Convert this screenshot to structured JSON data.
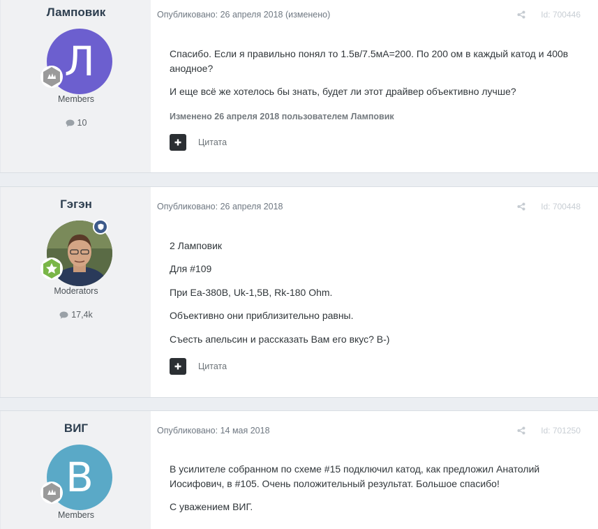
{
  "posts": [
    {
      "author": "Ламповик",
      "avatar_letter": "Л",
      "avatar_color": "#6c5fcf",
      "group": "Members",
      "post_count": "10",
      "published": "Опубликовано: 26 апреля 2018 (изменено)",
      "post_id": "Id: 700446",
      "paragraphs": [
        "Спасибо. Если я правильно понял то 1.5в/7.5мА=200. По 200 ом в каждый катод и 400в анодное?",
        "И еще всё же хотелось бы знать, будет ли этот драйвер объективно лучше?"
      ],
      "edited_note": "Изменено 26 апреля 2018 пользователем Ламповик",
      "quote_label": "Цитата"
    },
    {
      "author": "Гэгэн",
      "group": "Moderators",
      "post_count": "17,4k",
      "published": "Опубликовано: 26 апреля 2018",
      "post_id": "Id: 700448",
      "paragraphs": [
        "2 Ламповик",
        "Для #109",
        "При Ea-380В, Uk-1,5В, Rk-180 Ohm.",
        "Объективно они приблизительно равны.",
        "Съесть апельсин и рассказать Вам его вкус? B-)"
      ],
      "quote_label": "Цитата"
    },
    {
      "author": "ВИГ",
      "avatar_letter": "В",
      "avatar_color": "#5aa9c7",
      "group": "Members",
      "published": "Опубликовано: 14 мая 2018",
      "post_id": "Id: 701250",
      "paragraphs": [
        "В усилителе собранном по схеме #15 подключил катод, как предложил Анатолий Иосифович, в #105. Очень положительный результат. Большое спасибо!",
        "С уважением ВИГ."
      ]
    }
  ]
}
